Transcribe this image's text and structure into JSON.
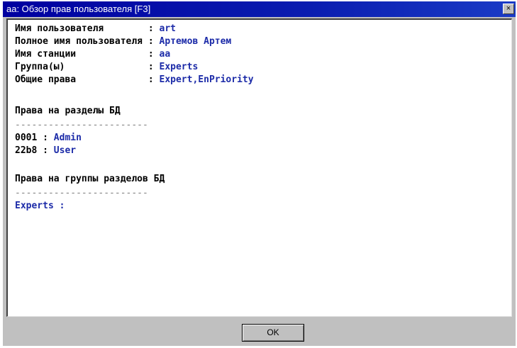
{
  "window": {
    "title": "aa: Обзор прав пользователя [F3]",
    "close_glyph": "×"
  },
  "fields": [
    {
      "label": "Имя пользователя        ",
      "value": "art"
    },
    {
      "label": "Полное имя пользователя ",
      "value": "Артемов Артем"
    },
    {
      "label": "Имя станции             ",
      "value": "aa"
    },
    {
      "label": "Группа(ы)               ",
      "value": "Experts"
    },
    {
      "label": "Общие права             ",
      "value": "Expert,EnPriority"
    }
  ],
  "field_separator": ": ",
  "sections": {
    "db_rights": {
      "heading": "Права на разделы БД",
      "divider": "------------------------",
      "items": [
        {
          "code": "0001",
          "value": "Admin"
        },
        {
          "code": "22b8",
          "value": "User"
        }
      ]
    },
    "db_group_rights": {
      "heading": "Права на группы разделов БД",
      "divider": "------------------------",
      "items": [
        {
          "value": "Experts :"
        }
      ]
    }
  },
  "footer": {
    "ok_label": "OK"
  },
  "colors": {
    "title_bar": "#0000a0",
    "value_text": "#1c2ba8",
    "window_bg": "#c0c0c0"
  }
}
